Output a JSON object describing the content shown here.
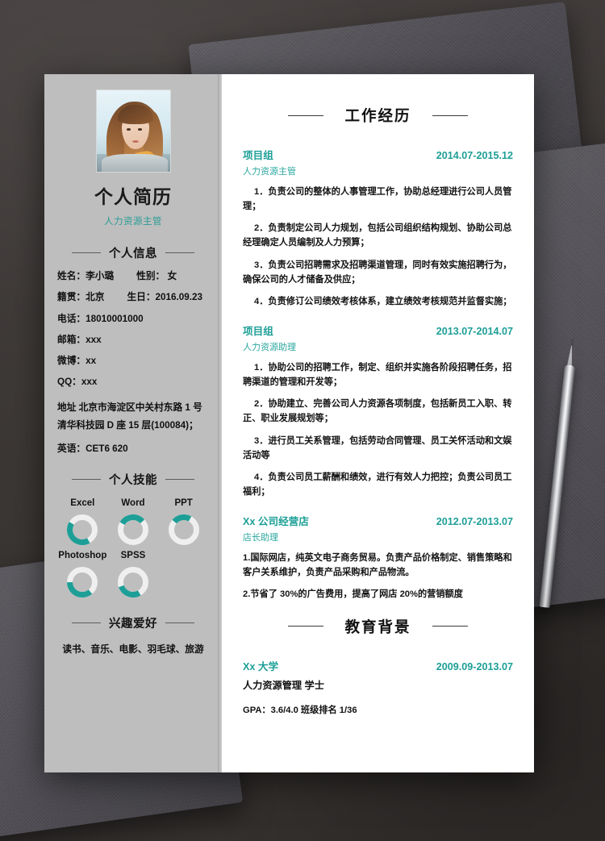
{
  "theme": {
    "accent": "#1d9f97",
    "accent_light": "#2aa79f",
    "sidebar_bg": "#bebebe",
    "page_bg": "#ffffff",
    "desk_bg": "#3e3a38"
  },
  "sidebar": {
    "photo_alt": "portrait-photo",
    "title": "个人简历",
    "subtitle": "人力资源主管",
    "info_heading": "个人信息",
    "info": {
      "name_label": "姓名：李小璐",
      "gender_label": "性别： 女",
      "hometown_label": "籍贯：北京",
      "birthday_label": "生日：2016.09.23",
      "phone_label": "电话：18010001000",
      "email_label": "邮箱：xxx",
      "weibo_label": "微博：xx",
      "qq_label": "QQ：xxx",
      "address_label": "地址 北京市海淀区中关村东路 1 号清华科技园 D 座 15 层(100084)；",
      "english_label": "英语：CET6 620"
    },
    "skills_heading": "个人技能",
    "skills": [
      {
        "label": "Excel",
        "percent": 42,
        "start_deg": 150
      },
      {
        "label": "Word",
        "percent": 30,
        "start_deg": 300
      },
      {
        "label": "PPT",
        "percent": 22,
        "start_deg": 310
      },
      {
        "label": "Photoshop",
        "percent": 36,
        "start_deg": 140
      },
      {
        "label": "SPSS",
        "percent": 28,
        "start_deg": 150
      }
    ],
    "hobbies_heading": "兴趣爱好",
    "hobbies_text": "读书、音乐、电影、羽毛球、旅游"
  },
  "main": {
    "work_heading": "工作经历",
    "jobs": [
      {
        "org": "项目组",
        "date": "2014.07-2015.12",
        "role": "人力资源主管",
        "bullets": [
          "1．负责公司的整体的人事管理工作，协助总经理进行公司人员管理；",
          "2．负责制定公司人力规划，包括公司组织结构规划、协助公司总经理确定人员编制及人力预算；",
          "3．负责公司招聘需求及招聘渠道管理，同时有效实施招聘行为，确保公司的人才储备及供应；",
          "4．负责修订公司绩效考核体系，建立绩效考核规范并监督实施；"
        ]
      },
      {
        "org": "项目组",
        "date": "2013.07-2014.07",
        "role": "人力资源助理",
        "bullets": [
          "1．协助公司的招聘工作，制定、组织并实施各阶段招聘任务，招聘渠道的管理和开发等；",
          "2．协助建立、完善公司人力资源各项制度，包括新员工入职、转正、职业发展规划等；",
          "3．进行员工关系管理，包括劳动合同管理、员工关怀活动和文娱活动等",
          "4．负责公司员工薪酬和绩效，进行有效人力把控；负责公司员工福利；"
        ]
      },
      {
        "org": "Xx 公司经营店",
        "date": "2012.07-2013.07",
        "role": "店长助理",
        "bullets": [
          "1.国际网店，纯英文电子商务贸易。负责产品价格制定、销售策略和客户关系维护，负责产品采购和产品物流。",
          "2.节省了 30%的广告费用，提高了网店 20%的营销额度"
        ]
      }
    ],
    "education_heading": "教育背景",
    "education": {
      "school": "Xx 大学",
      "date": "2009.09-2013.07",
      "major": "人力资源管理  学士",
      "gpa": "GPA：3.6/4.0   班级排名  1/36"
    }
  }
}
